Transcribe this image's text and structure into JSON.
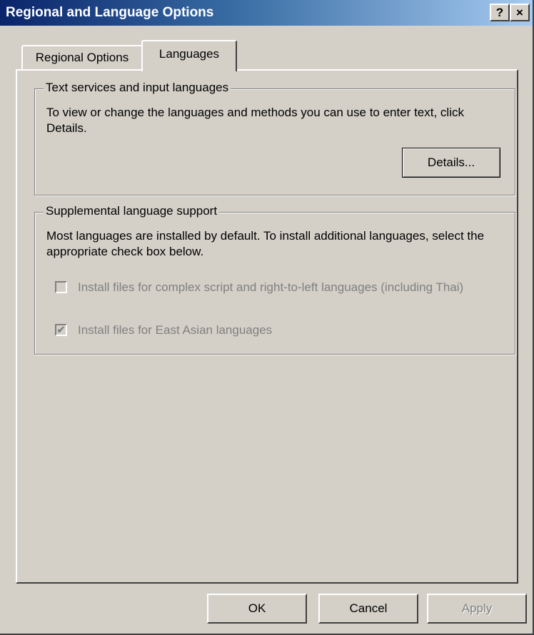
{
  "window": {
    "title": "Regional and Language Options",
    "help_label": "?",
    "close_label": "×"
  },
  "tabs": [
    {
      "label": "Regional Options",
      "active": false
    },
    {
      "label": "Languages",
      "active": true
    }
  ],
  "text_services": {
    "legend": "Text services and input languages",
    "description": "To view or change the languages and methods you can use to enter text, click Details.",
    "details_label": "Details..."
  },
  "supplemental": {
    "legend": "Supplemental language support",
    "description": "Most languages are installed by default. To install additional languages, select the appropriate check box below.",
    "complex_script": {
      "label": "Install files for complex script and right-to-left languages (including Thai)",
      "checked": false,
      "mark": ""
    },
    "east_asian": {
      "label": "Install files for East Asian languages",
      "checked": true,
      "mark": "✔"
    }
  },
  "buttons": {
    "ok": "OK",
    "cancel": "Cancel",
    "apply": "Apply"
  },
  "colors": {
    "face": "#d4d0c8",
    "title_start": "#0a246a",
    "title_end": "#a6caf0",
    "disabled_text": "#808080"
  }
}
